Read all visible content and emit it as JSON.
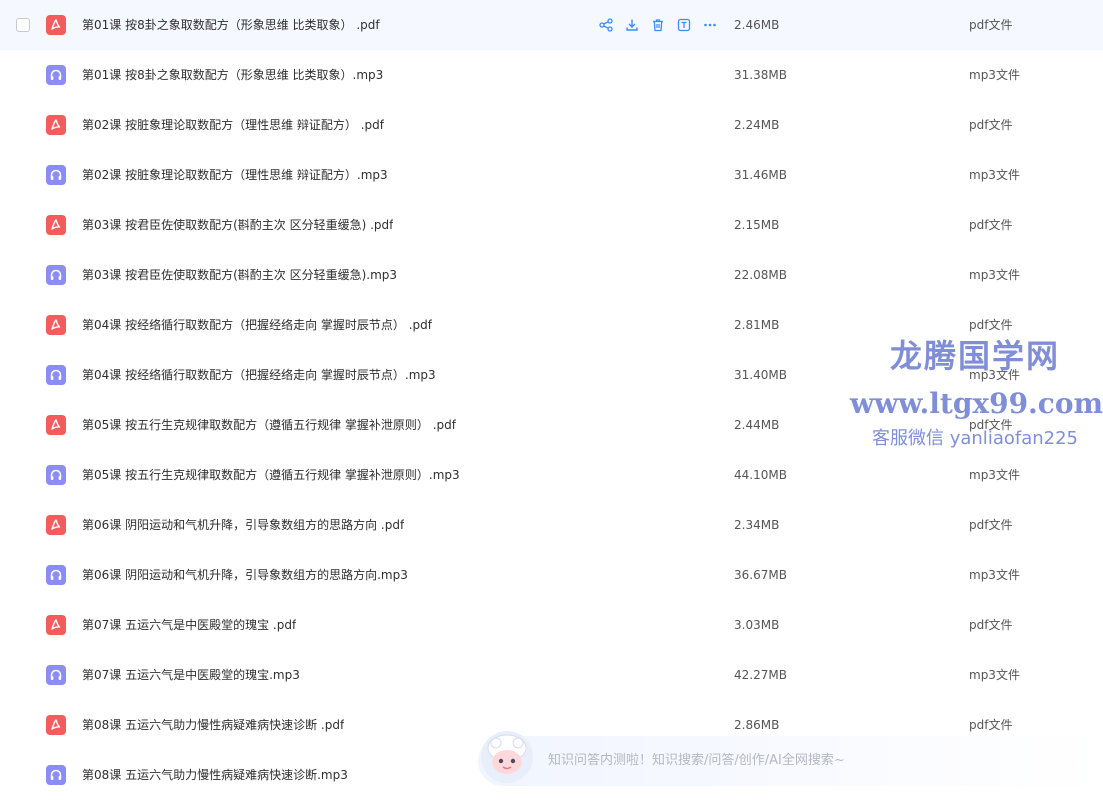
{
  "files": [
    {
      "name": "第01课 按8卦之象取数配方（形象思维 比类取象） .pdf",
      "size": "2.46MB",
      "type": "pdf文件",
      "kind": "pdf"
    },
    {
      "name": "第01课 按8卦之象取数配方（形象思维 比类取象）.mp3",
      "size": "31.38MB",
      "type": "mp3文件",
      "kind": "mp3"
    },
    {
      "name": "第02课 按脏象理论取数配方（理性思维 辩证配方） .pdf",
      "size": "2.24MB",
      "type": "pdf文件",
      "kind": "pdf"
    },
    {
      "name": "第02课 按脏象理论取数配方（理性思维 辩证配方）.mp3",
      "size": "31.46MB",
      "type": "mp3文件",
      "kind": "mp3"
    },
    {
      "name": "第03课 按君臣佐使取数配方(斟酌主次 区分轻重缓急) .pdf",
      "size": "2.15MB",
      "type": "pdf文件",
      "kind": "pdf"
    },
    {
      "name": "第03课 按君臣佐使取数配方(斟酌主次 区分轻重缓急).mp3",
      "size": "22.08MB",
      "type": "mp3文件",
      "kind": "mp3"
    },
    {
      "name": "第04课 按经络循行取数配方（把握经络走向 掌握时辰节点） .pdf",
      "size": "2.81MB",
      "type": "pdf文件",
      "kind": "pdf"
    },
    {
      "name": "第04课 按经络循行取数配方（把握经络走向 掌握时辰节点）.mp3",
      "size": "31.40MB",
      "type": "mp3文件",
      "kind": "mp3"
    },
    {
      "name": "第05课 按五行生克规律取数配方（遵循五行规律 掌握补泄原则） .pdf",
      "size": "2.44MB",
      "type": "pdf文件",
      "kind": "pdf"
    },
    {
      "name": "第05课 按五行生克规律取数配方（遵循五行规律 掌握补泄原则）.mp3",
      "size": "44.10MB",
      "type": "mp3文件",
      "kind": "mp3"
    },
    {
      "name": "第06课 阴阳运动和气机升降，引导象数组方的思路方向 .pdf",
      "size": "2.34MB",
      "type": "pdf文件",
      "kind": "pdf"
    },
    {
      "name": "第06课 阴阳运动和气机升降，引导象数组方的思路方向.mp3",
      "size": "36.67MB",
      "type": "mp3文件",
      "kind": "mp3"
    },
    {
      "name": "第07课 五运六气是中医殿堂的瑰宝 .pdf",
      "size": "3.03MB",
      "type": "pdf文件",
      "kind": "pdf"
    },
    {
      "name": "第07课 五运六气是中医殿堂的瑰宝.mp3",
      "size": "42.27MB",
      "type": "mp3文件",
      "kind": "mp3"
    },
    {
      "name": "第08课 五运六气助力慢性病疑难病快速诊断 .pdf",
      "size": "2.86MB",
      "type": "pdf文件",
      "kind": "pdf"
    },
    {
      "name": "第08课 五运六气助力慢性病疑难病快速诊断.mp3",
      "size": "",
      "type": "",
      "kind": "mp3"
    }
  ],
  "hover_row_index": 0,
  "row_action_icons": [
    "share-icon",
    "download-icon",
    "trash-icon",
    "rename-icon",
    "more-icon"
  ],
  "watermark": {
    "title": "龙腾国学网",
    "url": "www.ltgx99.com",
    "contact": "客服微信 yanliaofan225"
  },
  "assistant": {
    "text": "知识问答内测啦！知识搜索/问答/创作/AI全网搜索~"
  },
  "colors": {
    "pdf_icon": "#f25c5c",
    "mp3_icon": "#8c8cf5",
    "action_icon": "#3d8bf7",
    "hover_row": "#f5f8fe",
    "watermark": "#6f7fd2"
  }
}
